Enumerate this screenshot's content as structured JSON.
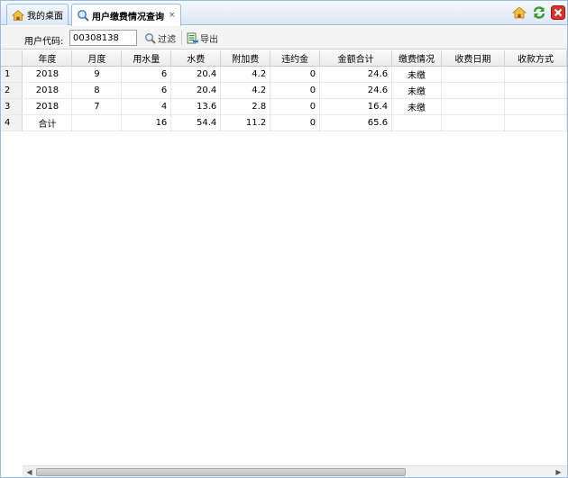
{
  "tabs": [
    {
      "label": "我的桌面",
      "icon": "home-icon",
      "active": false
    },
    {
      "label": "用户缴费情况查询",
      "icon": "search-icon",
      "active": true,
      "close": "×"
    }
  ],
  "toolbar": {
    "user_code_label": "用户代码:",
    "user_code_value": "00308138",
    "filter_label": "过滤",
    "export_label": "导出"
  },
  "table": {
    "columns": [
      "",
      "年度",
      "月度",
      "用水量",
      "水费",
      "附加费",
      "违约金",
      "金额合计",
      "缴费情况",
      "收费日期",
      "收款方式"
    ],
    "rows": [
      [
        "1",
        "2018",
        "9",
        "6",
        "20.4",
        "4.2",
        "0",
        "24.6",
        "未缴",
        "",
        ""
      ],
      [
        "2",
        "2018",
        "8",
        "6",
        "20.4",
        "4.2",
        "0",
        "24.6",
        "未缴",
        "",
        ""
      ],
      [
        "3",
        "2018",
        "7",
        "4",
        "13.6",
        "2.8",
        "0",
        "16.4",
        "未缴",
        "",
        ""
      ],
      [
        "4",
        "合计",
        "",
        "16",
        "54.4",
        "11.2",
        "0",
        "65.6",
        "",
        "",
        ""
      ]
    ]
  },
  "colors": {
    "border": "#99bbe8",
    "close_red": "#d9312b"
  }
}
